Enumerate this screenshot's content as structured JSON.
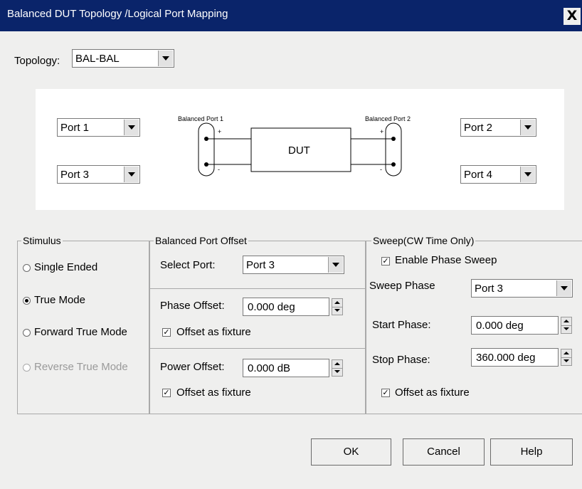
{
  "window": {
    "title": "Balanced DUT Topology /Logical Port Mapping",
    "close_glyph": "X"
  },
  "topology": {
    "label": "Topology:",
    "value": "BAL-BAL"
  },
  "diagram": {
    "port_left_top": "Port 1",
    "port_left_bottom": "Port 3",
    "port_right_top": "Port 2",
    "port_right_bottom": "Port 4",
    "balanced_port_1": "Balanced Port 1",
    "balanced_port_2": "Balanced Port 2",
    "dut": "DUT",
    "plus": "+",
    "minus": "-"
  },
  "stimulus": {
    "legend": "Stimulus",
    "options": [
      {
        "label": "Single Ended",
        "selected": false,
        "enabled": true
      },
      {
        "label": "True Mode",
        "selected": true,
        "enabled": true
      },
      {
        "label": "Forward True Mode",
        "selected": false,
        "enabled": true
      },
      {
        "label": "Reverse True Mode",
        "selected": false,
        "enabled": false
      }
    ]
  },
  "balanced_port_offset": {
    "legend": "Balanced Port Offset",
    "select_port_label": "Select Port:",
    "select_port_value": "Port 3",
    "phase_offset_label": "Phase Offset:",
    "phase_offset_value": "0.000 deg",
    "phase_fixture_label": "Offset as fixture",
    "power_offset_label": "Power Offset:",
    "power_offset_value": "0.000 dB",
    "power_fixture_label": "Offset as fixture"
  },
  "sweep": {
    "legend": "Sweep(CW Time Only)",
    "enable_label": "Enable Phase Sweep",
    "sweep_phase_label": "Sweep Phase",
    "sweep_phase_value": "Port 3",
    "start_label": "Start Phase:",
    "start_value": "0.000 deg",
    "stop_label": "Stop Phase:",
    "stop_value": "360.000 deg",
    "fixture_label": "Offset as fixture"
  },
  "buttons": {
    "ok": "OK",
    "cancel": "Cancel",
    "help": "Help"
  },
  "check_glyph": "✓",
  "colors": {
    "titlebar": "#0a246a",
    "dialog_bg": "#efefee"
  }
}
